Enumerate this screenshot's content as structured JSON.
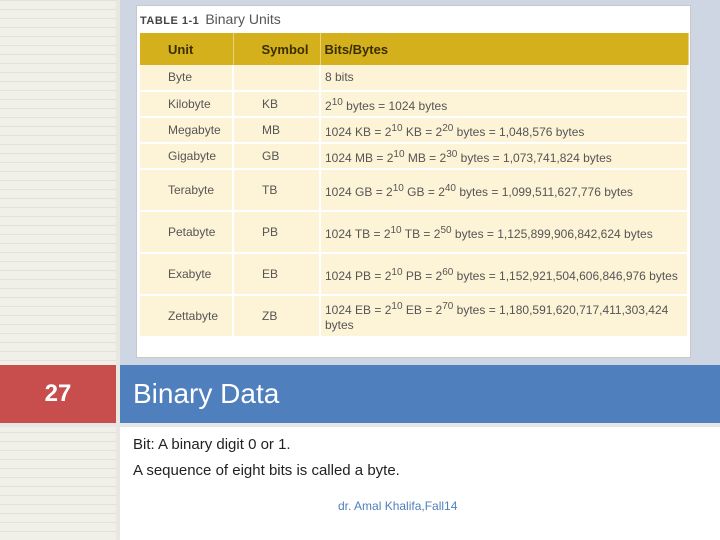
{
  "slide": {
    "number": "27",
    "title": "Binary Data",
    "lines": [
      "Bit: A binary digit 0 or 1.",
      "A sequence of eight bits is called a byte."
    ],
    "footer": "dr. Amal Khalifa,Fall14"
  },
  "table": {
    "label": "TABLE 1-1",
    "title": "Binary Units",
    "header": [
      "Unit",
      "Symbol",
      "Bits/Bytes"
    ],
    "rows": [
      [
        "Byte",
        "",
        "8 bits"
      ],
      [
        "Kilobyte",
        "KB",
        "2<sup>10</sup> bytes = 1024 bytes"
      ],
      [
        "Megabyte",
        "MB",
        "1024 KB = 2<sup>10</sup> KB = 2<sup>20</sup> bytes = 1,048,576 bytes"
      ],
      [
        "Gigabyte",
        "GB",
        "1024 MB = 2<sup>10</sup> MB = 2<sup>30</sup> bytes = 1,073,741,824 bytes"
      ],
      [
        "Terabyte",
        "TB",
        "1024 GB = 2<sup>10</sup> GB = 2<sup>40</sup> bytes = 1,099,511,627,776 bytes"
      ],
      [
        "Petabyte",
        "PB",
        "1024 TB = 2<sup>10</sup> TB = 2<sup>50</sup> bytes = 1,125,899,906,842,624 bytes"
      ],
      [
        "Exabyte",
        "EB",
        "1024 PB = 2<sup>10</sup> PB = 2<sup>60</sup> bytes = 1,152,921,504,606,846,976 bytes"
      ],
      [
        "Zettabyte",
        "ZB",
        "1024 EB = 2<sup>10</sup> EB = 2<sup>70</sup> bytes = 1,180,591,620,717,411,303,424 bytes"
      ]
    ],
    "colors": {
      "header_bg": "#d4b01c",
      "row_bg": "#fdf3d6"
    }
  },
  "colors": {
    "number_block": "#c84d4d",
    "title_bar": "#4f7fbd"
  }
}
